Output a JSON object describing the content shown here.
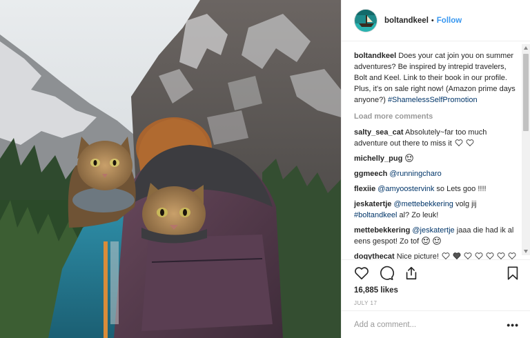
{
  "header": {
    "username": "boltandkeel",
    "separator": "•",
    "follow_label": "Follow",
    "avatar_icon": "avatar-boat-icon"
  },
  "caption": {
    "username": "boltandkeel",
    "text": "Does your cat join you on summer adventures? Be inspired by intrepid travelers, Bolt and Keel. Link to their book in our profile. Plus, it's on sale right now! (Amazon prime days anyone?)",
    "hashtag": "#ShamelessSelfPromotion"
  },
  "load_more_label": "Load more comments",
  "comments": [
    {
      "username": "salty_sea_cat",
      "text": "Absolutely~far too much adventure out there to miss it",
      "emoji": [
        "white-heart-icon",
        "white-heart-icon"
      ]
    },
    {
      "username": "michelly_pug",
      "text": "",
      "emoji": [
        "heart-eyes-icon"
      ]
    },
    {
      "username": "ggmeech",
      "mention": "@runningcharo",
      "text": ""
    },
    {
      "username": "flexiie",
      "mention": "@amyoostervink",
      "text": "so Lets goo !!!!"
    },
    {
      "username": "jeskatertje",
      "mention": "@mettebekkering",
      "text": "volg jij",
      "hashtag": "#boltandkeel",
      "text2": "al? Zo leuk!"
    },
    {
      "username": "mettebekkering",
      "mention": "@jeskatertje",
      "text": "jaaa die had ik al eens gespot! Zo tof",
      "emoji": [
        "heart-eyes-icon",
        "heart-eyes-icon"
      ]
    },
    {
      "username": "dogythecat",
      "text": "Nice picture!",
      "emoji": [
        "white-heart-icon",
        "black-heart-icon",
        "white-heart-icon",
        "white-heart-icon",
        "white-heart-icon",
        "white-heart-icon",
        "white-heart-icon"
      ]
    }
  ],
  "actions": {
    "like_icon": "heart-icon",
    "comment_icon": "comment-icon",
    "share_icon": "share-icon",
    "save_icon": "bookmark-icon"
  },
  "likes": "16,885 likes",
  "date": "JULY 17",
  "add_comment": {
    "placeholder": "Add a comment...",
    "more_label": "•••"
  },
  "colors": {
    "link": "#3897f0",
    "hashtag": "#003569",
    "muted": "#999999",
    "text": "#262626"
  }
}
